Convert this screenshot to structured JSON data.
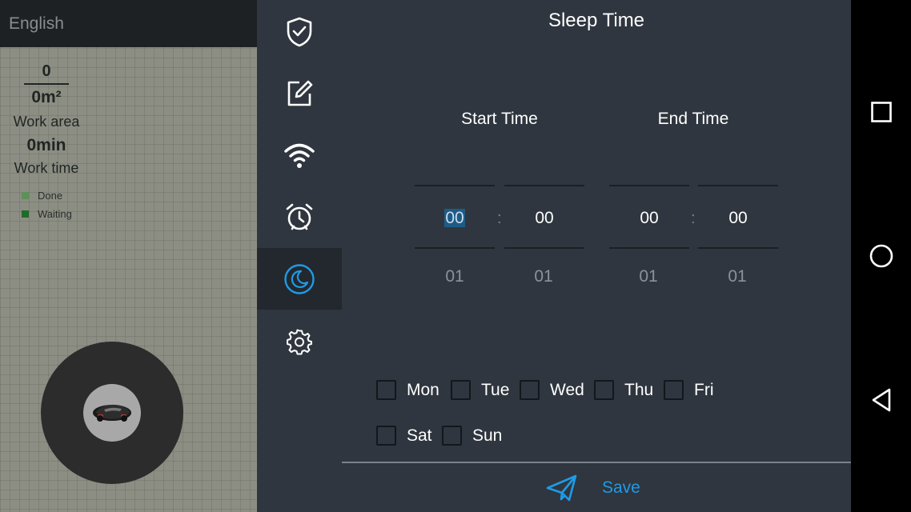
{
  "left_panel": {
    "language": "English",
    "area_count": "0",
    "area_value": "0m²",
    "area_label": "Work area",
    "time_value": "0min",
    "time_label": "Work time",
    "legend": [
      {
        "label": "Done",
        "color": "#5f8f5a"
      },
      {
        "label": "Waiting",
        "color": "#1f6b2a"
      }
    ]
  },
  "nav": {
    "items": [
      {
        "icon": "shield-check-icon"
      },
      {
        "icon": "edit-icon"
      },
      {
        "icon": "wifi-icon"
      },
      {
        "icon": "alarm-clock-icon"
      },
      {
        "icon": "moon-icon",
        "active": true
      },
      {
        "icon": "gear-icon"
      }
    ],
    "accent": "#1e9be6"
  },
  "sleep": {
    "title": "Sleep Time",
    "start_label": "Start Time",
    "end_label": "End Time",
    "start_hour": "00",
    "start_minute": "00",
    "end_hour": "00",
    "end_minute": "00",
    "start_hour_next": "01",
    "start_minute_next": "01",
    "end_hour_next": "01",
    "end_minute_next": "01",
    "separator": ":",
    "days": [
      {
        "label": "Mon",
        "checked": false
      },
      {
        "label": "Tue",
        "checked": false
      },
      {
        "label": "Wed",
        "checked": false
      },
      {
        "label": "Thu",
        "checked": false
      },
      {
        "label": "Fri",
        "checked": false
      },
      {
        "label": "Sat",
        "checked": false
      },
      {
        "label": "Sun",
        "checked": false
      }
    ],
    "save_label": "Save"
  },
  "system_bar": {
    "buttons": [
      "recents-icon",
      "home-icon",
      "back-icon"
    ]
  }
}
